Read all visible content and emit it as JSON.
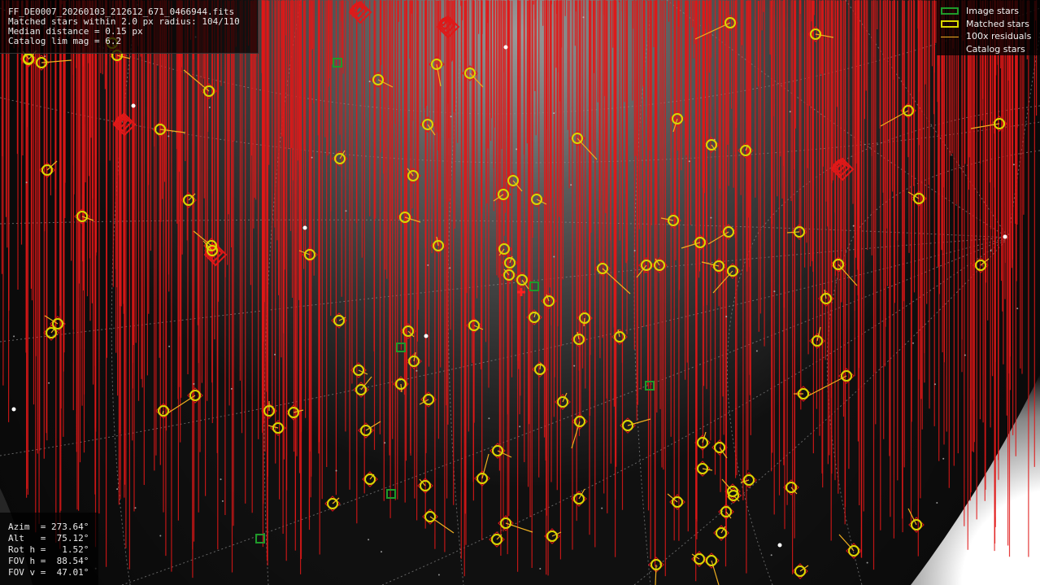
{
  "info": {
    "filename": "FF_DE0007_20260103_212612_671_0466944.fits",
    "matched": "Matched stars within 2.0 px radius: 104/110",
    "median": "Median distance = 0.15 px",
    "limmag": "Catalog lim mag = 6.2"
  },
  "pointing": {
    "azim": "Azim  = 273.64°",
    "alt": "Alt   =  75.12°",
    "roth": "Rot h =   1.52°",
    "fovh": "FOV h =  88.54°",
    "fovv": "FOV v =  47.01°"
  },
  "legend": {
    "image_stars": "Image stars",
    "matched_stars": "Matched stars",
    "residuals": "100x residuals",
    "catalog_stars": "Catalog stars"
  },
  "colors": {
    "image_star": "#1f9a2a",
    "matched_star": "#d8d800",
    "residual": "#f0b020",
    "catalog_star": "#e01818",
    "grid": "#8a8a8a",
    "sky_dark": "#0a0a0a",
    "sky_glow": "#e8e8e8"
  },
  "matched_stars": [
    [
      51,
      77,
      88,
      74
    ],
    [
      35,
      73,
      45,
      62
    ],
    [
      144,
      68,
      160,
      72
    ],
    [
      257,
      112,
      226,
      86
    ],
    [
      197,
      159,
      228,
      163
    ],
    [
      58,
      209,
      70,
      198
    ],
    [
      101,
      266,
      115,
      271
    ],
    [
      232,
      246,
      240,
      238
    ],
    [
      260,
      302,
      238,
      284
    ],
    [
      261,
      308,
      250,
      296
    ],
    [
      465,
      98,
      483,
      107
    ],
    [
      537,
      79,
      542,
      106
    ],
    [
      578,
      90,
      594,
      107
    ],
    [
      526,
      153,
      535,
      166
    ],
    [
      418,
      195,
      424,
      185
    ],
    [
      508,
      216,
      501,
      207
    ],
    [
      631,
      222,
      642,
      235
    ],
    [
      619,
      239,
      607,
      247
    ],
    [
      660,
      245,
      672,
      251
    ],
    [
      498,
      267,
      517,
      273
    ],
    [
      539,
      302,
      537,
      291
    ],
    [
      381,
      313,
      368,
      308
    ],
    [
      620,
      306,
      614,
      314
    ],
    [
      627,
      323,
      630,
      315
    ],
    [
      626,
      338,
      620,
      331
    ],
    [
      642,
      344,
      650,
      355
    ],
    [
      675,
      370,
      672,
      362
    ],
    [
      657,
      390,
      659,
      383
    ],
    [
      710,
      170,
      734,
      196
    ],
    [
      741,
      330,
      775,
      361
    ],
    [
      795,
      326,
      783,
      341
    ],
    [
      811,
      326,
      806,
      318
    ],
    [
      828,
      271,
      813,
      268
    ],
    [
      833,
      146,
      828,
      162
    ],
    [
      875,
      178,
      880,
      185
    ],
    [
      917,
      185,
      920,
      178
    ],
    [
      1003,
      42,
      1025,
      46
    ],
    [
      898,
      28,
      855,
      48
    ],
    [
      1117,
      136,
      1083,
      155
    ],
    [
      1229,
      152,
      1194,
      158
    ],
    [
      1130,
      244,
      1117,
      236
    ],
    [
      983,
      285,
      968,
      286
    ],
    [
      896,
      285,
      871,
      300
    ],
    [
      861,
      298,
      838,
      305
    ],
    [
      884,
      327,
      863,
      322
    ],
    [
      901,
      333,
      877,
      360
    ],
    [
      1031,
      325,
      1054,
      351
    ],
    [
      1016,
      367,
      1014,
      356
    ],
    [
      1206,
      326,
      1216,
      318
    ],
    [
      719,
      391,
      718,
      401
    ],
    [
      712,
      417,
      710,
      408
    ],
    [
      762,
      414,
      760,
      405
    ],
    [
      1005,
      419,
      1009,
      402
    ],
    [
      1041,
      462,
      991,
      488
    ],
    [
      988,
      484,
      976,
      484
    ],
    [
      583,
      400,
      594,
      405
    ],
    [
      502,
      407,
      509,
      414
    ],
    [
      509,
      444,
      511,
      433
    ],
    [
      417,
      394,
      425,
      390
    ],
    [
      441,
      455,
      452,
      460
    ],
    [
      444,
      479,
      457,
      463
    ],
    [
      493,
      472,
      494,
      482
    ],
    [
      527,
      491,
      516,
      497
    ],
    [
      664,
      454,
      665,
      446
    ],
    [
      692,
      494,
      697,
      483
    ],
    [
      713,
      518,
      703,
      551
    ],
    [
      772,
      523,
      800,
      515
    ],
    [
      864,
      544,
      868,
      531
    ],
    [
      885,
      550,
      894,
      563
    ],
    [
      864,
      576,
      876,
      578
    ],
    [
      71,
      398,
      55,
      388
    ],
    [
      63,
      409,
      68,
      403
    ],
    [
      240,
      486,
      206,
      508
    ],
    [
      201,
      505,
      200,
      509
    ],
    [
      331,
      505,
      331,
      493
    ],
    [
      342,
      526,
      330,
      523
    ],
    [
      361,
      507,
      373,
      504
    ],
    [
      450,
      529,
      468,
      518
    ],
    [
      612,
      554,
      629,
      562
    ],
    [
      593,
      588,
      601,
      558
    ],
    [
      455,
      589,
      460,
      583
    ],
    [
      523,
      597,
      516,
      589
    ],
    [
      409,
      619,
      417,
      612
    ],
    [
      529,
      635,
      558,
      655
    ],
    [
      622,
      643,
      655,
      654
    ],
    [
      611,
      663,
      617,
      657
    ],
    [
      679,
      659,
      690,
      654
    ],
    [
      712,
      613,
      719,
      601
    ],
    [
      833,
      617,
      821,
      607
    ],
    [
      901,
      604,
      888,
      589
    ],
    [
      902,
      609,
      909,
      616
    ],
    [
      921,
      590,
      911,
      593
    ],
    [
      973,
      599,
      980,
      607
    ],
    [
      893,
      629,
      899,
      637
    ],
    [
      887,
      655,
      892,
      647
    ],
    [
      860,
      687,
      851,
      681
    ],
    [
      875,
      689,
      884,
      719
    ],
    [
      807,
      694,
      806,
      719
    ],
    [
      984,
      702,
      994,
      695
    ],
    [
      1050,
      677,
      1032,
      657
    ],
    [
      1127,
      645,
      1117,
      625
    ],
    [
      138,
      53,
      142,
      58
    ],
    [
      35,
      72,
      28,
      63
    ]
  ],
  "image_stars": [
    [
      415,
      77
    ],
    [
      493,
      427
    ],
    [
      799,
      474
    ],
    [
      481,
      607
    ],
    [
      320,
      662
    ],
    [
      657,
      352
    ]
  ],
  "gridlines": [
    "M 0 10 Q 300 140 620 140 Q 950 135 1279 10",
    "M 0 120 Q 350 200 640 200 Q 950 200 1279 150",
    "M 0 275 Q 600 260 1240 292",
    "M 0 420 Q 500 360 800 330 Q 1050 305 1240 292",
    "M 0 560 Q 500 480 1240 292",
    "M 150 719 Q 600 560 1240 292",
    "M 470 719 Q 900 530 1240 292",
    "M 780 719 Q 1050 500 1240 292",
    "M 1279 40 Q 1260 160 1240 292",
    "M 1040 0 Q 1150 160 1240 292",
    "M 820 0 Q 1040 170 1240 292",
    "M 370 0 Q 310 330 330 719",
    "M 170 0 Q 110 380 160 719",
    "M 575 0 Q 530 330 570 719",
    "M 800 20 Q 760 330 800 719",
    "M 1279 185 Q 1100 210 1050 290 Q 980 420 1060 719",
    "M 1279 130 Q 1020 160 930 290 Q 850 450 950 719"
  ],
  "dark_stars": [
    [
      622,
      58
    ],
    [
      164,
      130
    ],
    [
      375,
      280
    ],
    [
      524,
      413
    ],
    [
      959,
      670
    ],
    [
      17,
      503
    ],
    [
      1236,
      291
    ]
  ]
}
